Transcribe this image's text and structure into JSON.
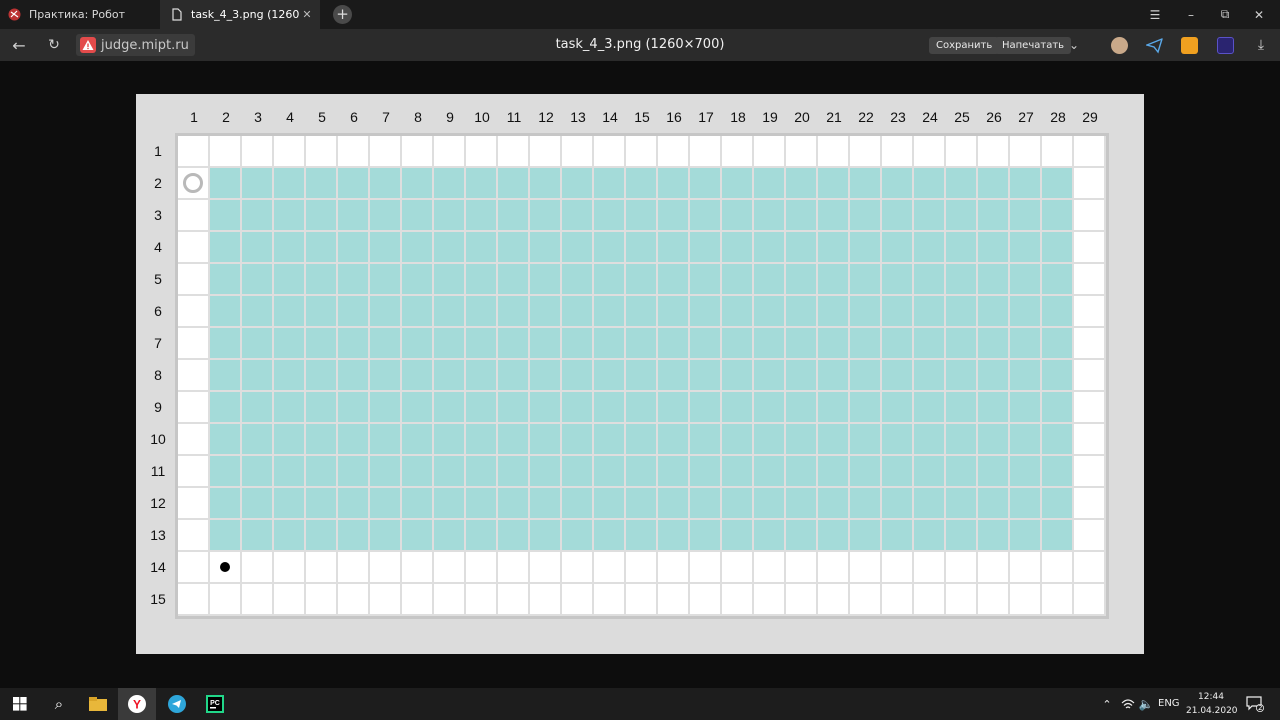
{
  "browser": {
    "tabs": [
      {
        "label": "Практика: Робот",
        "active": false
      },
      {
        "label": "task_4_3.png (1260×700)",
        "active": true
      }
    ],
    "address": "judge.mipt.ru",
    "page_title": "task_4_3.png (1260×700)",
    "save_label": "Сохранить",
    "print_label": "Напечатать"
  },
  "grid": {
    "columns": [
      "1",
      "2",
      "3",
      "4",
      "5",
      "6",
      "7",
      "8",
      "9",
      "10",
      "11",
      "12",
      "13",
      "14",
      "15",
      "16",
      "17",
      "18",
      "19",
      "20",
      "21",
      "22",
      "23",
      "24",
      "25",
      "26",
      "27",
      "28",
      "29"
    ],
    "rows": [
      "1",
      "2",
      "3",
      "4",
      "5",
      "6",
      "7",
      "8",
      "9",
      "10",
      "11",
      "12",
      "13",
      "14",
      "15"
    ],
    "filled_region": {
      "row_from": 2,
      "row_to": 13,
      "col_from": 2,
      "col_to": 28
    },
    "robot_cell": {
      "row": 2,
      "col": 1
    },
    "marker_cell": {
      "row": 14,
      "col": 2
    },
    "fill_color": "#a4dbd9"
  },
  "taskbar": {
    "lang": "ENG",
    "time": "12:44",
    "date": "21.04.2020",
    "notifications": "2"
  }
}
